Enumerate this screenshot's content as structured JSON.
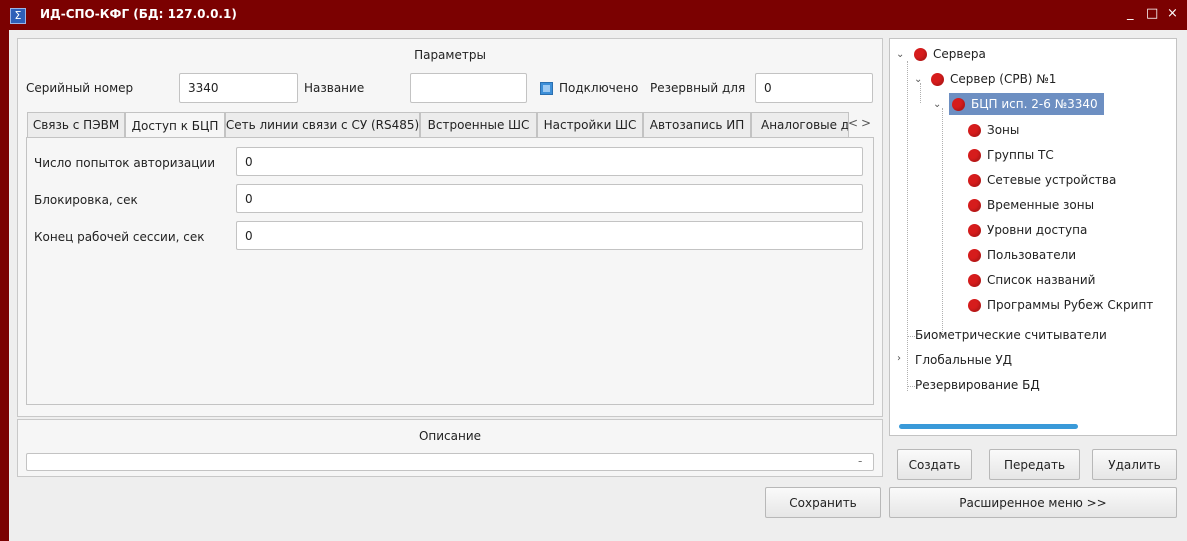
{
  "window": {
    "title": "ИД-СПО-КФГ (БД: 127.0.0.1)",
    "icon": "Σ",
    "minimize": "_",
    "maximize": "□",
    "close": "×"
  },
  "params": {
    "header": "Параметры",
    "serial_label": "Серийный номер",
    "serial_value": "3340",
    "name_label": "Название",
    "name_value": "",
    "connected_label": "Подключено",
    "connected_checked": true,
    "reserve_label": "Резервный для",
    "reserve_value": "0"
  },
  "tabs": [
    {
      "label": "Связь с ПЭВМ",
      "active": false
    },
    {
      "label": "Доступ к БЦП",
      "active": true
    },
    {
      "label": "Сеть линии связи с СУ (RS485)",
      "active": false
    },
    {
      "label": "Встроенные ШС",
      "active": false
    },
    {
      "label": "Настройки ШС",
      "active": false
    },
    {
      "label": "Автозапись ИП",
      "active": false
    },
    {
      "label": "Аналоговые д",
      "active": false
    }
  ],
  "tab_scroll": {
    "left": "<",
    "right": ">"
  },
  "fields": [
    {
      "label": "Число попыток авторизации",
      "value": "0"
    },
    {
      "label": "Блокировка, сек",
      "value": "0"
    },
    {
      "label": "Конец рабочей сессии, сек",
      "value": "0"
    }
  ],
  "description": {
    "header": "Описание",
    "value": "",
    "dropdown": "-"
  },
  "buttons": {
    "save": "Сохранить",
    "create": "Создать",
    "transfer": "Передать",
    "delete": "Удалить",
    "extended": "Расширенное меню >>"
  },
  "tree": {
    "servers": "Сервера",
    "server": "Сервер (СРВ) №1",
    "bcp": "БЦП исп. 2-6 №3340",
    "children": [
      "Зоны",
      "Группы ТС",
      "Сетевые устройства",
      "Временные зоны",
      "Уровни доступа",
      "Пользователи",
      "Список названий",
      "Программы Рубеж Скрипт"
    ],
    "biometric": "Биометрические считыватели",
    "global": "Глобальные УД",
    "reserve_db": "Резервирование БД"
  },
  "colors": {
    "titlebar": "#7b0101",
    "node_dot": "#d61c1c",
    "selection": "#6d8fc2",
    "progress": "#3a9ad9"
  }
}
